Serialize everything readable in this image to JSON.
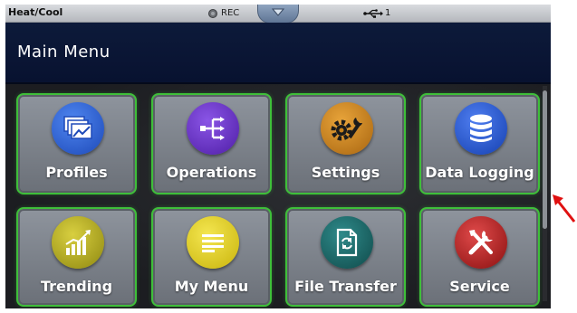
{
  "status_bar": {
    "mode": "Heat/Cool",
    "rec_label": "REC",
    "usb_count": "1"
  },
  "header": {
    "title": "Main Menu"
  },
  "menu": {
    "items": [
      {
        "label": "Profiles",
        "icon": "profiles-icon",
        "color": "#2b5fd6"
      },
      {
        "label": "Operations",
        "icon": "operations-icon",
        "color": "#6a2cc8"
      },
      {
        "label": "Settings",
        "icon": "settings-icon",
        "color": "#c8821a"
      },
      {
        "label": "Data Logging",
        "icon": "database-icon",
        "color": "#1e50c8"
      },
      {
        "label": "Trending",
        "icon": "trending-icon",
        "color": "#b8b01e"
      },
      {
        "label": "My Menu",
        "icon": "my-menu-icon",
        "color": "#e3d020"
      },
      {
        "label": "File Transfer",
        "icon": "file-transfer-icon",
        "color": "#1a6a6a"
      },
      {
        "label": "Service",
        "icon": "service-icon",
        "color": "#b81e1e"
      }
    ]
  },
  "colors": {
    "tile_border": "#3fbf3a",
    "title_bar": "#0d1a3a",
    "annotation_arrow": "#e01010"
  }
}
